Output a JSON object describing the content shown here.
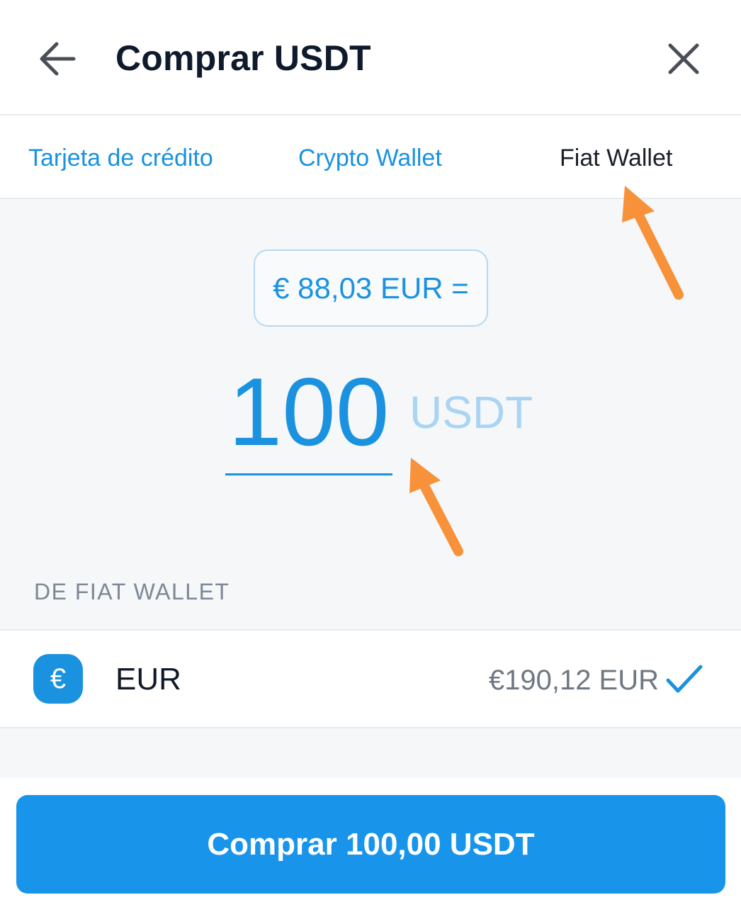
{
  "header": {
    "title": "Comprar USDT",
    "back_icon": "arrow-left-icon",
    "close_icon": "close-icon"
  },
  "tabs": [
    {
      "label": "Tarjeta de crédito",
      "active": false
    },
    {
      "label": "Crypto Wallet",
      "active": false
    },
    {
      "label": "Fiat Wallet",
      "active": true
    }
  ],
  "conversion": {
    "rate_text": "€ 88,03 EUR ="
  },
  "amount": {
    "value": "100",
    "unit": "USDT"
  },
  "source": {
    "section_label": "DE FIAT WALLET",
    "wallet": {
      "icon_symbol": "€",
      "name": "EUR",
      "balance": "€190,12 EUR",
      "selected": true
    }
  },
  "buy_button": {
    "label": "Comprar 100,00 USDT"
  },
  "colors": {
    "accent": "#1a92e0",
    "button": "#1894ea",
    "annotation_arrow": "#f7923a"
  }
}
